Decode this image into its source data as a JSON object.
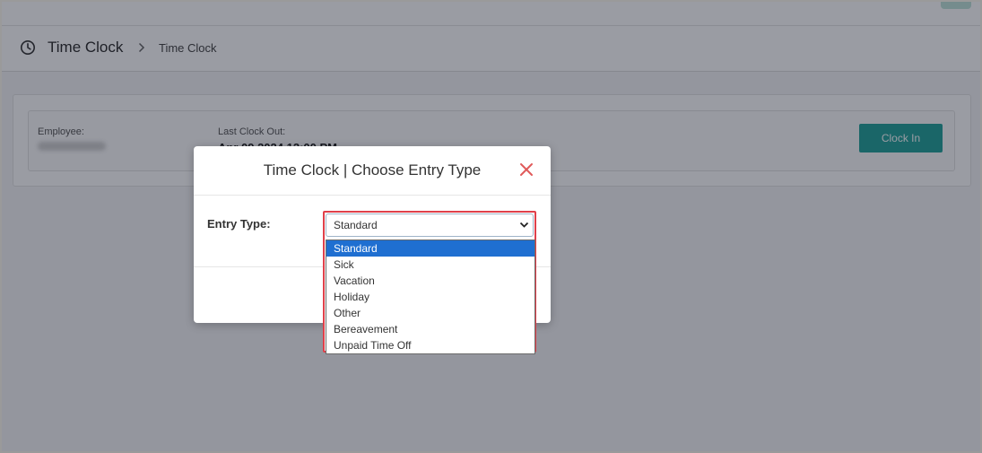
{
  "header": {
    "title": "Time Clock",
    "breadcrumb": "Time Clock"
  },
  "employee_card": {
    "employee_label": "Employee:",
    "last_clock_out_label": "Last Clock Out:",
    "last_clock_out_value": "Apr 09 2024 12:00 PM",
    "clock_in_label": "Clock In"
  },
  "modal": {
    "title": "Time Clock | Choose Entry Type",
    "entry_type_label": "Entry Type:",
    "select": {
      "value": "Standard",
      "options": [
        "Standard",
        "Sick",
        "Vacation",
        "Holiday",
        "Other",
        "Bereavement",
        "Unpaid Time Off"
      ],
      "selected_index": 0
    }
  },
  "colors": {
    "accent": "#23a39a",
    "highlight": "#e0404a",
    "selected_option": "#1f6fd1",
    "close_icon": "#e05a5a"
  }
}
